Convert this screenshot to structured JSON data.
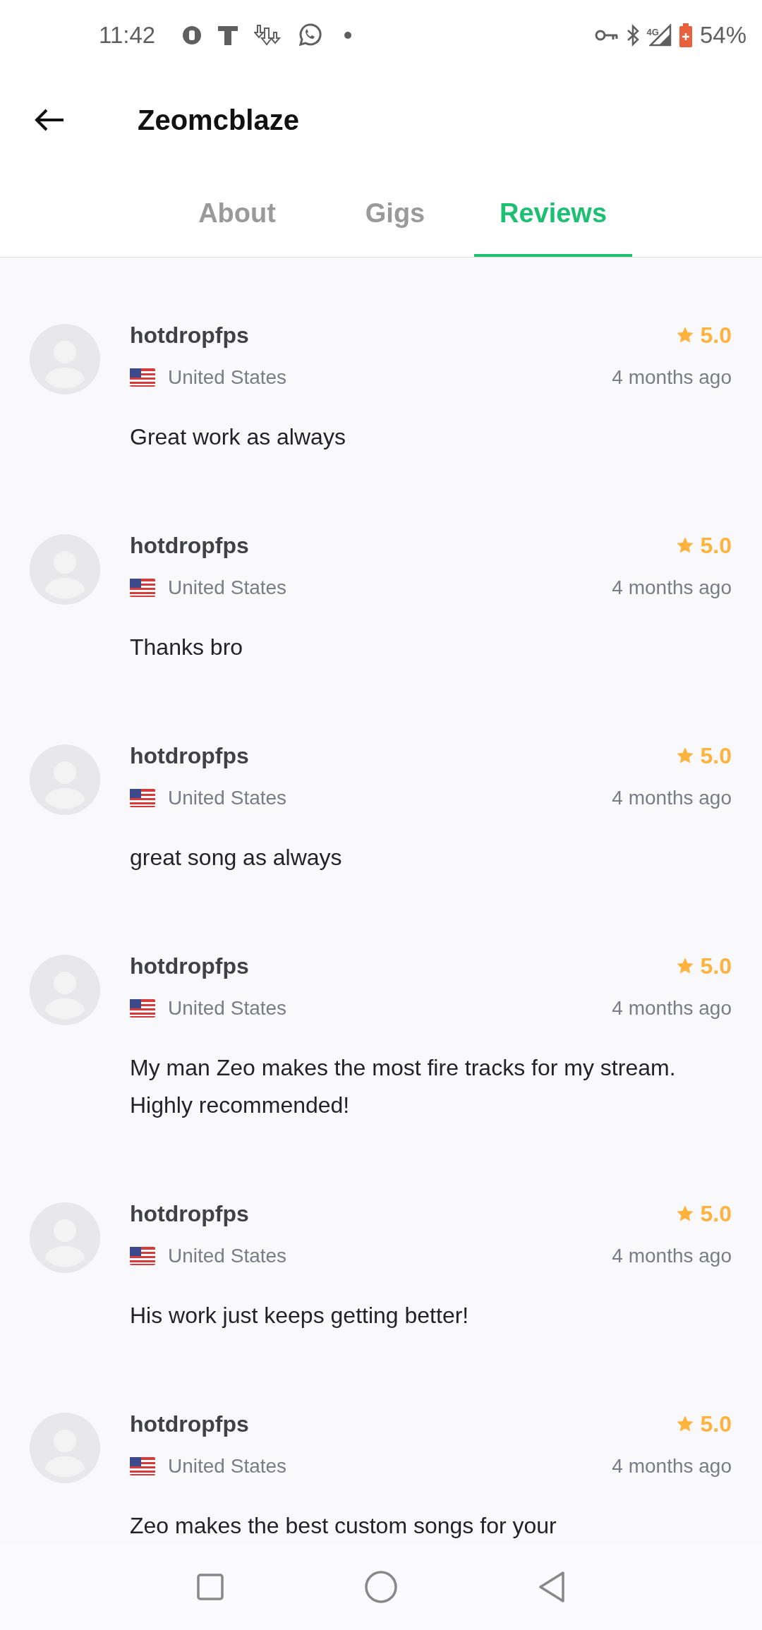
{
  "status_bar": {
    "time": "11:42",
    "network_type": "4G",
    "battery": "54%"
  },
  "header": {
    "title": "Zeomcblaze"
  },
  "tabs": [
    {
      "label": "About",
      "selected": false
    },
    {
      "label": "Gigs",
      "selected": false
    },
    {
      "label": "Reviews",
      "selected": true
    }
  ],
  "reviews": [
    {
      "name": "hotdropfps",
      "country": "United States",
      "rating": "5.0",
      "time": "4 months ago",
      "text": "Great work as always"
    },
    {
      "name": "hotdropfps",
      "country": "United States",
      "rating": "5.0",
      "time": "4 months ago",
      "text": "Thanks bro"
    },
    {
      "name": "hotdropfps",
      "country": "United States",
      "rating": "5.0",
      "time": "4 months ago",
      "text": "great song as always"
    },
    {
      "name": "hotdropfps",
      "country": "United States",
      "rating": "5.0",
      "time": "4 months ago",
      "text": "My man Zeo makes the most fire tracks for my stream. Highly recommended!"
    },
    {
      "name": "hotdropfps",
      "country": "United States",
      "rating": "5.0",
      "time": "4 months ago",
      "text": "His work just keeps getting better!"
    },
    {
      "name": "hotdropfps",
      "country": "United States",
      "rating": "5.0",
      "time": "4 months ago",
      "text": "Zeo makes the best custom songs for your"
    }
  ]
}
